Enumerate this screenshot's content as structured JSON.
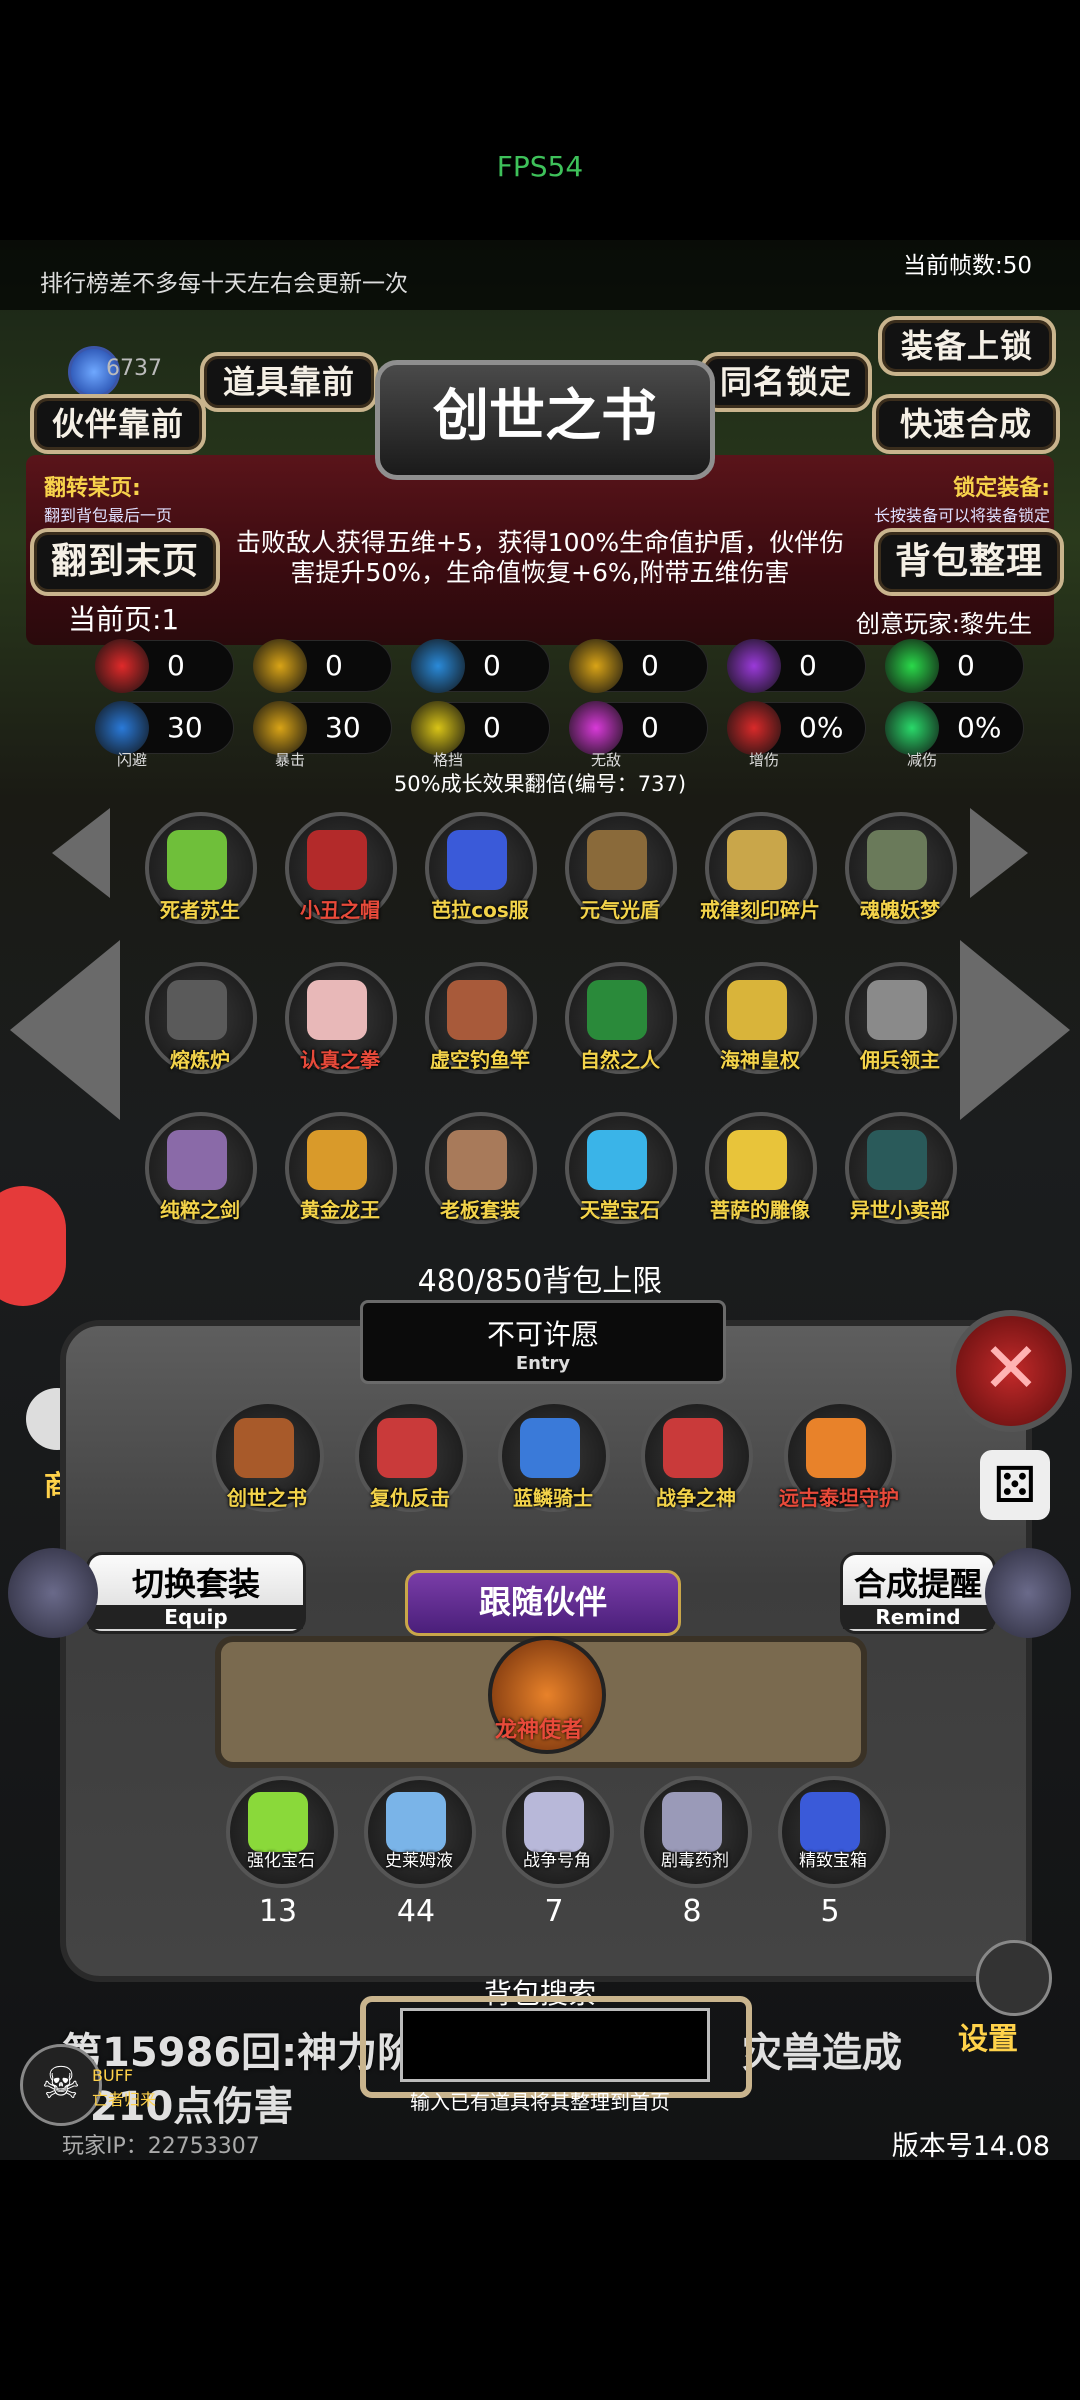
{
  "status": {
    "fps": "FPS54"
  },
  "topbar": {
    "notice": "排行榜差不多每十天左右会更新一次",
    "frame_count": "当前帧数:50"
  },
  "currency": {
    "amount": "6737"
  },
  "buttons": {
    "items_front": "道具靠前",
    "partner_front": "伙伴靠前",
    "same_name_lock": "同名锁定",
    "equip_lock": "装备上锁",
    "quick_craft": "快速合成",
    "to_last_page": "翻到末页",
    "bag_sort": "背包整理"
  },
  "book": {
    "title": "创世之书",
    "flip_label": "翻转某页:",
    "flip_sub": "翻到背包最后一页",
    "lock_label": "锁定装备:",
    "lock_sub": "长按装备可以将装备锁定",
    "description": "击败敌人获得五维+5，获得100%生命值护盾，伙伴伤害提升50%，生命值恢复+6%,附带五维伤害",
    "current_page": "当前页:1",
    "creator": "创意玩家:黎先生",
    "growth": "50%成长效果翻倍(编号：737)"
  },
  "stats_row1": [
    {
      "icon": "heart-icon",
      "value": "0",
      "color": "#e02a2a"
    },
    {
      "icon": "strength-icon",
      "value": "0",
      "color": "#d9a417"
    },
    {
      "icon": "helmet-icon",
      "value": "0",
      "color": "#2a8ad9"
    },
    {
      "icon": "sword-icon",
      "value": "0",
      "color": "#d9a417"
    },
    {
      "icon": "lightning-icon",
      "value": "0",
      "color": "#9a3ad9"
    },
    {
      "icon": "clover-icon",
      "value": "0",
      "color": "#2ad94a"
    }
  ],
  "stats_row2": [
    {
      "icon": "dodge-icon",
      "value": "30",
      "sub": "闪避",
      "color": "#2a7ad9"
    },
    {
      "icon": "crit-icon",
      "value": "30",
      "sub": "暴击",
      "color": "#d9a417"
    },
    {
      "icon": "block-icon",
      "value": "0",
      "sub": "格挡",
      "color": "#d9c417"
    },
    {
      "icon": "invincible-icon",
      "value": "0",
      "sub": "无敌",
      "color": "#d93ad9"
    },
    {
      "icon": "damage-up-icon",
      "value": "0%",
      "sub": "增伤",
      "color": "#d92a2a"
    },
    {
      "icon": "damage-down-icon",
      "value": "0%",
      "sub": "减伤",
      "color": "#2ad96a"
    }
  ],
  "items": [
    {
      "label": "死者苏生",
      "color": "#f3d34a",
      "icon_color": "#6fbf3a"
    },
    {
      "label": "小丑之帽",
      "color": "#e84a3a",
      "icon_color": "#b32a2a"
    },
    {
      "label": "芭拉cos服",
      "color": "#f3d34a",
      "icon_color": "#3a5ad9"
    },
    {
      "label": "元气光盾",
      "color": "#f3d34a",
      "icon_color": "#8a6a3a"
    },
    {
      "label": "戒律刻印碎片",
      "color": "#f3d34a",
      "icon_color": "#c9a64a"
    },
    {
      "label": "魂魄妖梦",
      "color": "#f3d34a",
      "icon_color": "#6a7a5a"
    },
    {
      "label": "熔炼炉",
      "color": "#f3d34a",
      "icon_color": "#5a5a5a"
    },
    {
      "label": "认真之拳",
      "color": "#e84a3a",
      "icon_color": "#e8b8b8"
    },
    {
      "label": "虚空钓鱼竿",
      "color": "#f3d34a",
      "icon_color": "#a85a3a"
    },
    {
      "label": "自然之人",
      "color": "#f3d34a",
      "icon_color": "#2a8a3a"
    },
    {
      "label": "海神皇权",
      "color": "#f3d34a",
      "icon_color": "#d9b43a"
    },
    {
      "label": "佣兵领主",
      "color": "#f3d34a",
      "icon_color": "#8a8a8a"
    },
    {
      "label": "纯粹之剑",
      "color": "#f3d34a",
      "icon_color": "#8a6aa8"
    },
    {
      "label": "黄金龙王",
      "color": "#f3d34a",
      "icon_color": "#d99a2a"
    },
    {
      "label": "老板套装",
      "color": "#f3d34a",
      "icon_color": "#a87a5a"
    },
    {
      "label": "天堂宝石",
      "color": "#f3d34a",
      "icon_color": "#3ab4e8"
    },
    {
      "label": "菩萨的雕像",
      "color": "#f3d34a",
      "icon_color": "#e8c43a"
    },
    {
      "label": "异世小卖部",
      "color": "#f3d34a",
      "icon_color": "#2a5a5a"
    }
  ],
  "bag": {
    "capacity": "480/850背包上限"
  },
  "wish": {
    "title": "不可许愿",
    "sub": "Entry"
  },
  "partners": [
    {
      "label": "创世之书",
      "color": "#f3d34a",
      "icon_color": "#a85a2a"
    },
    {
      "label": "复仇反击",
      "color": "#f3d34a",
      "icon_color": "#c93a3a"
    },
    {
      "label": "蓝鳞骑士",
      "color": "#f3d34a",
      "icon_color": "#3a7ad9"
    },
    {
      "label": "战争之神",
      "color": "#f3d34a",
      "icon_color": "#c93a3a"
    },
    {
      "label": "远古泰坦守护",
      "color": "#e84a3a",
      "icon_color": "#e8822a"
    }
  ],
  "equip": {
    "label": "切换套装",
    "sub": "Equip"
  },
  "remind": {
    "label": "合成提醒",
    "sub": "Remind"
  },
  "follow": {
    "title": "跟随伙伴",
    "partner": "龙神使者"
  },
  "resources": [
    {
      "label": "强化宝石",
      "value": "13",
      "icon_color": "#8ad93a"
    },
    {
      "label": "史莱姆液",
      "value": "44",
      "icon_color": "#7ab4e8"
    },
    {
      "label": "战争号角",
      "value": "7",
      "icon_color": "#b8b8d9"
    },
    {
      "label": "剧毒药剂",
      "value": "8",
      "icon_color": "#9a9ab8"
    },
    {
      "label": "精致宝箱",
      "value": "5",
      "icon_color": "#3a5ad9"
    }
  ],
  "search": {
    "title": "背包搜索",
    "hint": "输入已有道具将其整理到首页"
  },
  "battle": {
    "line1": "第15986回:神力阶",
    "line2": "9210点伤害",
    "line3": "灾兽造成"
  },
  "footer": {
    "player_ip": "玩家IP：22753307",
    "version": "版本号14.08",
    "buff": "BUFF",
    "buff_sub": "亡者归来"
  },
  "side": {
    "shop": "商",
    "settings": "设置"
  }
}
